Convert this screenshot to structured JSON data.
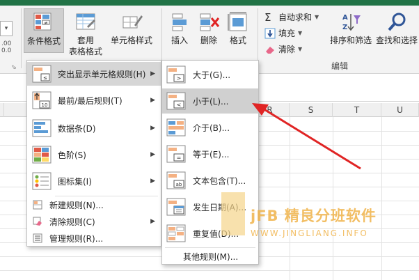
{
  "ribbon": {
    "conditional_format": "条件格式",
    "table_format_1": "套用",
    "table_format_2": "表格格式",
    "cell_style": "单元格样式",
    "insert": "插入",
    "delete": "删除",
    "format": "格式",
    "autosum": "自动求和",
    "fill": "填充",
    "clear": "清除",
    "sort_filter": "排序和筛选",
    "find_select": "查找和选择",
    "edit_group": "编辑",
    "left_num_top": ".00",
    "left_num_bottom": "0.0"
  },
  "columns": [
    "R",
    "S",
    "T",
    "U"
  ],
  "main_menu": {
    "items": [
      {
        "label": "突出显示单元格规则(H)",
        "has_submenu": true
      },
      {
        "label": "最前/最后规则(T)",
        "has_submenu": true
      },
      {
        "label": "数据条(D)",
        "has_submenu": true
      },
      {
        "label": "色阶(S)",
        "has_submenu": true
      },
      {
        "label": "图标集(I)",
        "has_submenu": true
      }
    ],
    "small_items": [
      {
        "label": "新建规则(N)..."
      },
      {
        "label": "清除规则(C)",
        "has_submenu": true
      },
      {
        "label": "管理规则(R)..."
      }
    ]
  },
  "submenu": {
    "items": [
      {
        "label": "大于(G)..."
      },
      {
        "label": "小于(L)..."
      },
      {
        "label": "介于(B)..."
      },
      {
        "label": "等于(E)..."
      },
      {
        "label": "文本包含(T)..."
      },
      {
        "label": "发生日期(A)..."
      },
      {
        "label": "重复值(D)..."
      }
    ],
    "other_rules": "其他规则(M)..."
  },
  "watermark": {
    "title": "jFB 精良分班软件",
    "subtitle": "WWW.JINGLIANG.INFO"
  },
  "colors": {
    "accent_green": "#217346",
    "arrow_red": "#e02424",
    "watermark": "#f0b34a"
  }
}
